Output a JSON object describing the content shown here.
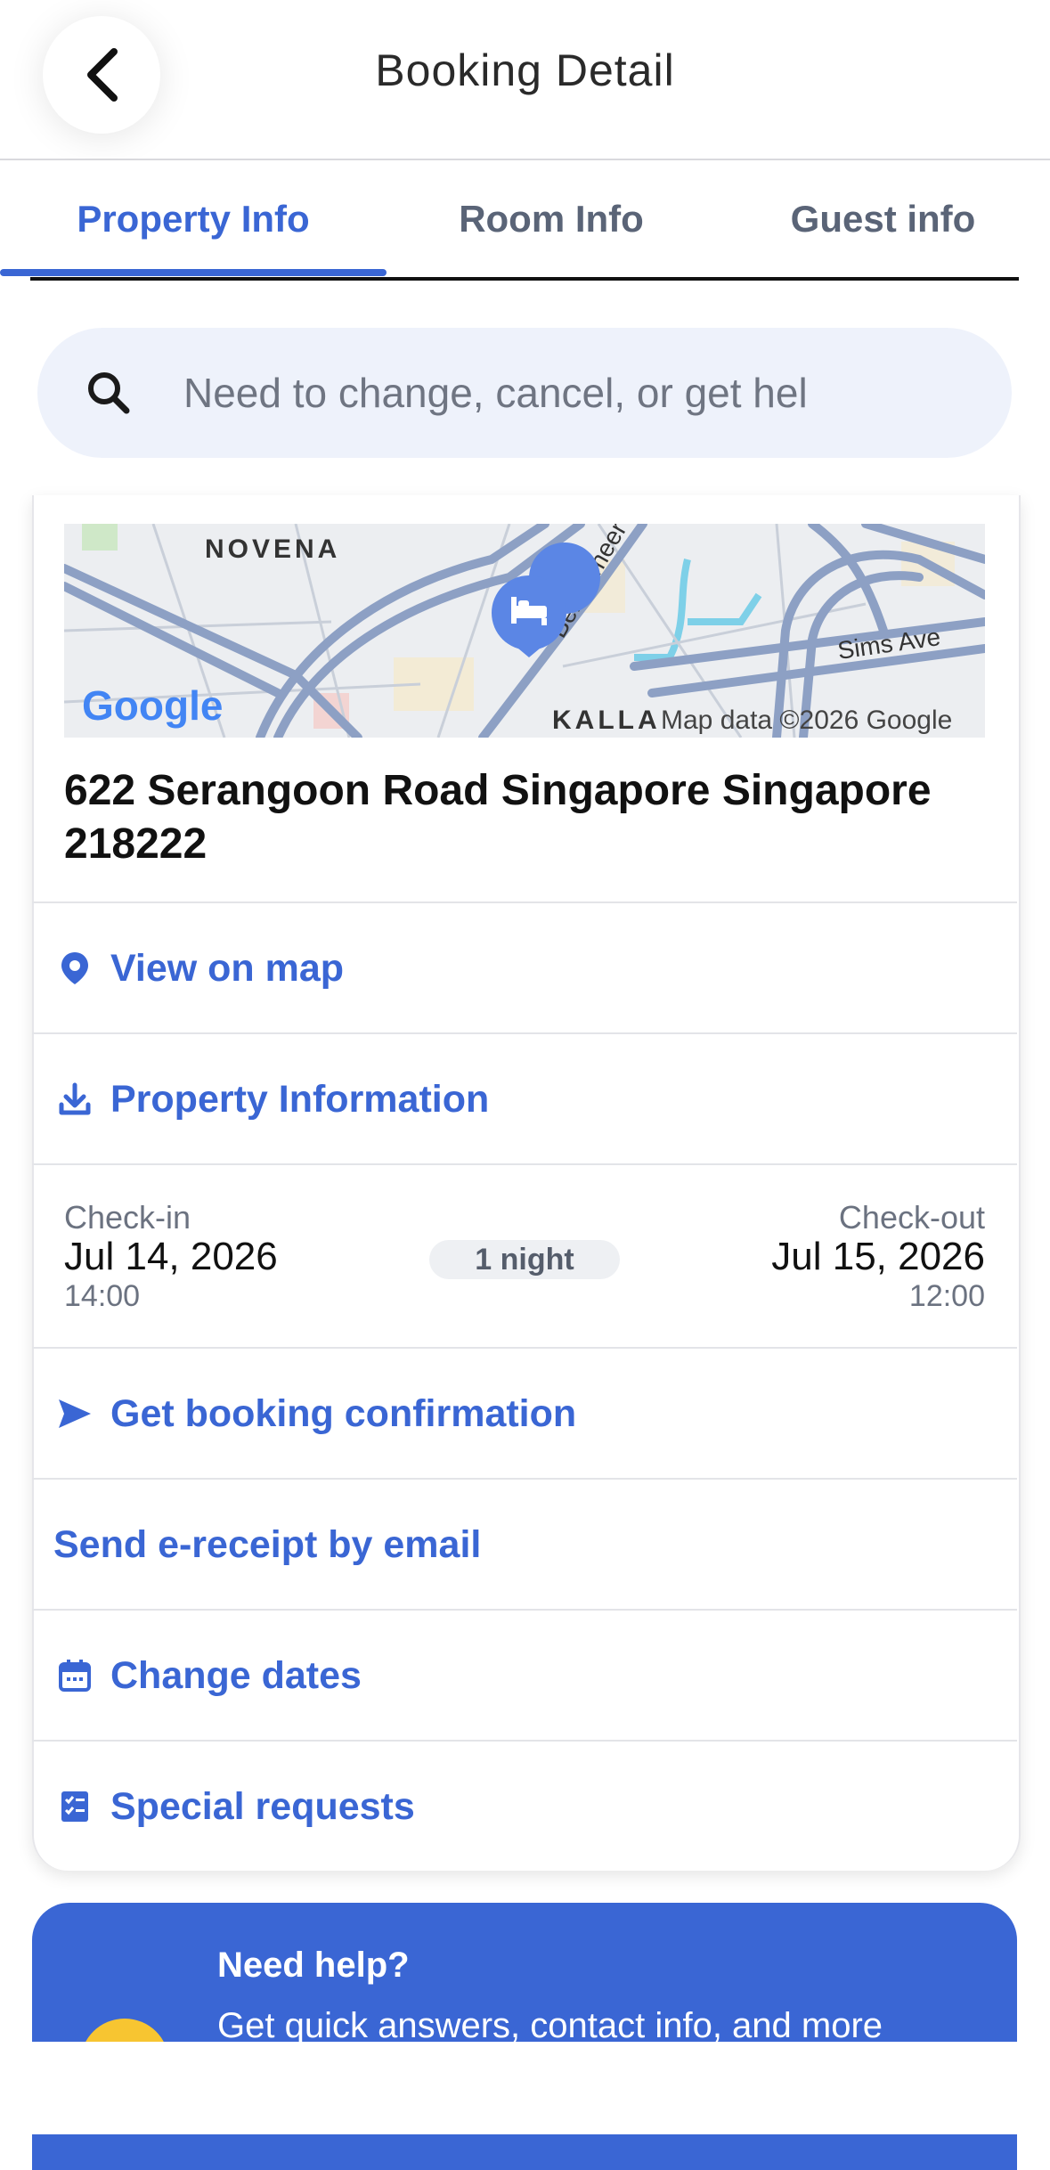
{
  "header": {
    "title": "Booking Detail"
  },
  "tabs": [
    {
      "label": "Property Info",
      "active": true
    },
    {
      "label": "Room Info",
      "active": false
    },
    {
      "label": "Guest info",
      "active": false
    }
  ],
  "search": {
    "placeholder": "Need to change, cancel, or get hel"
  },
  "map": {
    "labels": {
      "area": "NOVENA",
      "road1": "Bendemeer",
      "road2": "Sims Ave",
      "area2": "KALLA",
      "logo": "Google",
      "credit": "Map data ©2026 Google"
    }
  },
  "property": {
    "address": "622 Serangoon Road Singapore Singapore 218222"
  },
  "actions": {
    "view_map": "View on map",
    "property_info": "Property Information",
    "booking_confirmation": "Get booking confirmation",
    "e_receipt": "Send e-receipt by email",
    "change_dates": "Change dates",
    "special_requests": "Special requests"
  },
  "stay": {
    "checkin_label": "Check-in",
    "checkin_date": "Jul 14, 2026",
    "checkin_time": "14:00",
    "nights": "1 night",
    "checkout_label": "Check-out",
    "checkout_date": "Jul 15, 2026",
    "checkout_time": "12:00"
  },
  "help": {
    "title": "Need help?",
    "subtitle": "Get quick answers, contact info, and more"
  },
  "colors": {
    "accent": "#3a66d4",
    "map_road": "#8da0c4"
  }
}
